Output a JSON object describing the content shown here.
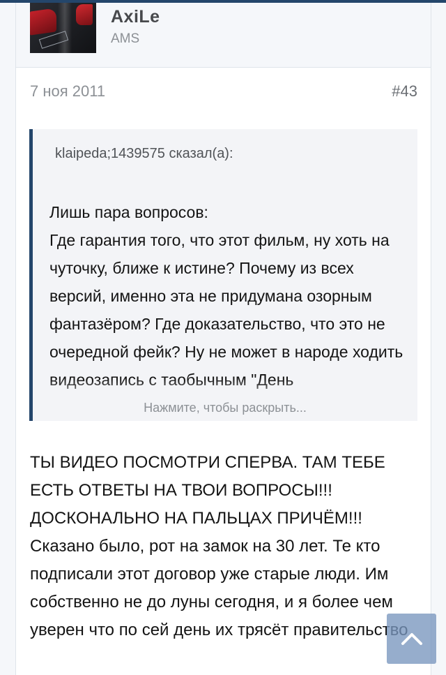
{
  "colors": {
    "accent": "#24466b",
    "page_background": "#f5f7fa",
    "quote_background": "#f3f4f7",
    "scroll_button": "#7896be"
  },
  "user": {
    "name": "AxiLe",
    "title": "AMS",
    "avatar_icon": "user-avatar-image"
  },
  "post": {
    "date": "7 ноя 2011",
    "number": "#43"
  },
  "quote": {
    "header": "klaipeda;1439575 сказал(а):",
    "body": "Лишь пара вопросов:\nГде гарантия того, что этот фильм, ну хоть на чуточку, ближе к истине? Почему из всех версий, именно эта не придумана озорным фантазёром? Где доказательство, что это не очередной фейк? Ну не может в народе ходить видеозапись с таобычным \"День",
    "expand_label": "Нажмите, чтобы раскрыть..."
  },
  "message": {
    "text": "ТЫ ВИДЕО ПОСМОТРИ СПЕРВА. ТАМ ТЕБЕ ЕСТЬ ОТВЕТЫ НА ТВОИ ВОПРОСЫ!!! ДОСКОНАЛЬНО НА ПАЛЬЦАХ ПРИЧЁМ!!! Сказано было, рот на замок на 30 лет. Те кто подписали этот договор уже старые люди. Им собственно не до луны сегодня, и я более чем уверен что по сей день их трясёт правительство"
  },
  "scroll_top": {
    "icon": "chevron-up-icon"
  }
}
